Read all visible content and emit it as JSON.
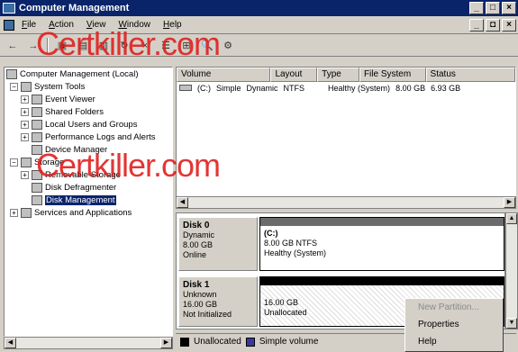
{
  "window": {
    "title": "Computer Management",
    "controls": [
      "_",
      "□",
      "×"
    ]
  },
  "menu": {
    "items": [
      "File",
      "Action",
      "View",
      "Window",
      "Help"
    ],
    "child_controls": [
      "_",
      "◘",
      "×"
    ]
  },
  "toolbar": {
    "buttons": [
      "←",
      "→",
      "▣",
      "▤",
      "▥",
      "↻",
      "×",
      "☰",
      "⊞",
      "🔍",
      "⚙"
    ]
  },
  "watermark": {
    "text": "Certkiller.com"
  },
  "tree": {
    "items": [
      {
        "label": "Computer Management (Local)",
        "level": 0,
        "expander": ""
      },
      {
        "label": "System Tools",
        "level": 1,
        "expander": "−"
      },
      {
        "label": "Event Viewer",
        "level": 2,
        "expander": "+"
      },
      {
        "label": "Shared Folders",
        "level": 2,
        "expander": "+"
      },
      {
        "label": "Local Users and Groups",
        "level": 2,
        "expander": "+"
      },
      {
        "label": "Performance Logs and Alerts",
        "level": 2,
        "expander": "+"
      },
      {
        "label": "Device Manager",
        "level": 2,
        "expander": ""
      },
      {
        "label": "Storage",
        "level": 1,
        "expander": "−"
      },
      {
        "label": "Removable Storage",
        "level": 2,
        "expander": "+"
      },
      {
        "label": "Disk Defragmenter",
        "level": 2,
        "expander": ""
      },
      {
        "label": "Disk Management",
        "level": 2,
        "expander": "",
        "selected": true
      },
      {
        "label": "Services and Applications",
        "level": 1,
        "expander": "+"
      }
    ]
  },
  "volumes": {
    "columns": [
      "Volume",
      "Layout",
      "Type",
      "File System",
      "Status"
    ],
    "rows": [
      {
        "volume": "(C:)",
        "layout": "Simple",
        "type": "Dynamic",
        "fs": "NTFS",
        "status": "Healthy (System)",
        "capacity": "8.00 GB",
        "free": "6.93 GB"
      }
    ]
  },
  "disks": [
    {
      "name": "Disk 0",
      "kind": "Dynamic",
      "size": "8.00 GB",
      "state": "Online",
      "part_title": "(C:)",
      "part_size": "8.00 GB NTFS",
      "part_status": "Healthy (System)",
      "bar_color": "#6b6b6b"
    },
    {
      "name": "Disk 1",
      "kind": "Unknown",
      "size": "16.00 GB",
      "state": "Not Initialized",
      "part_title": "",
      "part_size": "16.00 GB",
      "part_status": "Unallocated",
      "bar_color": "#000000"
    }
  ],
  "context_menu": {
    "items": [
      "New Partition...",
      "Properties",
      "Help"
    ]
  },
  "legend": {
    "items": [
      {
        "label": "Unallocated",
        "color": "#000000"
      },
      {
        "label": "Simple volume",
        "color": "#3a3a9a"
      }
    ]
  }
}
